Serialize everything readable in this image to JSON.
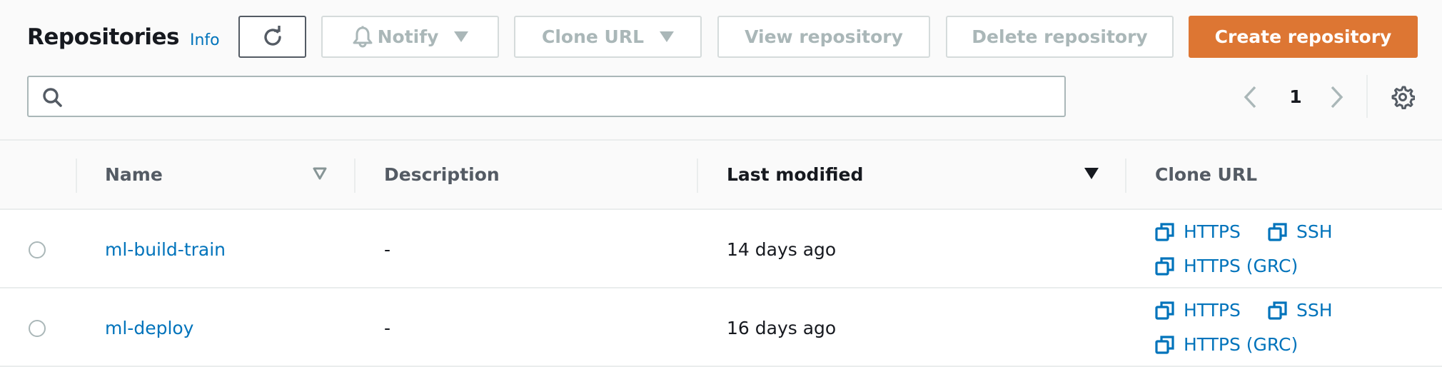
{
  "header": {
    "title": "Repositories",
    "info_label": "Info"
  },
  "toolbar": {
    "refresh_icon": "refresh-icon",
    "notify_label": "Notify",
    "notify_icon": "bell-icon",
    "clone_url_label": "Clone URL",
    "view_repository_label": "View repository",
    "delete_repository_label": "Delete repository",
    "create_repository_label": "Create repository"
  },
  "search": {
    "value": "",
    "placeholder": "",
    "icon": "search-icon"
  },
  "pagination": {
    "current_page": "1",
    "prev_icon": "chevron-left-icon",
    "next_icon": "chevron-right-icon",
    "settings_icon": "gear-icon"
  },
  "colors": {
    "accent": "#dd7633",
    "link": "#0073bb",
    "disabled_text": "#aab7b8",
    "border": "#eaeded"
  },
  "table": {
    "columns": [
      {
        "label": "Name",
        "sort": "unsorted"
      },
      {
        "label": "Description"
      },
      {
        "label": "Last modified",
        "sort": "descending"
      },
      {
        "label": "Clone URL"
      }
    ],
    "rows": [
      {
        "name": "ml-build-train",
        "description": "-",
        "last_modified": "14 days ago",
        "clone_links": [
          "HTTPS",
          "SSH",
          "HTTPS (GRC)"
        ],
        "selected": false
      },
      {
        "name": "ml-deploy",
        "description": "-",
        "last_modified": "16 days ago",
        "clone_links": [
          "HTTPS",
          "SSH",
          "HTTPS (GRC)"
        ],
        "selected": false
      }
    ]
  }
}
